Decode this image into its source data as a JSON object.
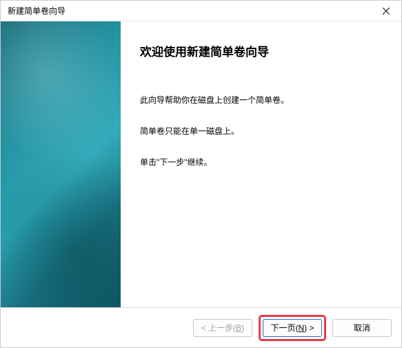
{
  "titlebar": {
    "title": "新建简单卷向导"
  },
  "main": {
    "heading": "欢迎使用新建简单卷向导",
    "paragraph1": "此向导帮助你在磁盘上创建一个简单卷。",
    "paragraph2": "简单卷只能在单一磁盘上。",
    "paragraph3": "单击\"下一步\"继续。"
  },
  "buttons": {
    "back_prefix": "< 上一步(",
    "back_key": "B",
    "back_suffix": ")",
    "next_prefix": "下一页(",
    "next_key": "N",
    "next_suffix": ") >",
    "cancel": "取消"
  }
}
